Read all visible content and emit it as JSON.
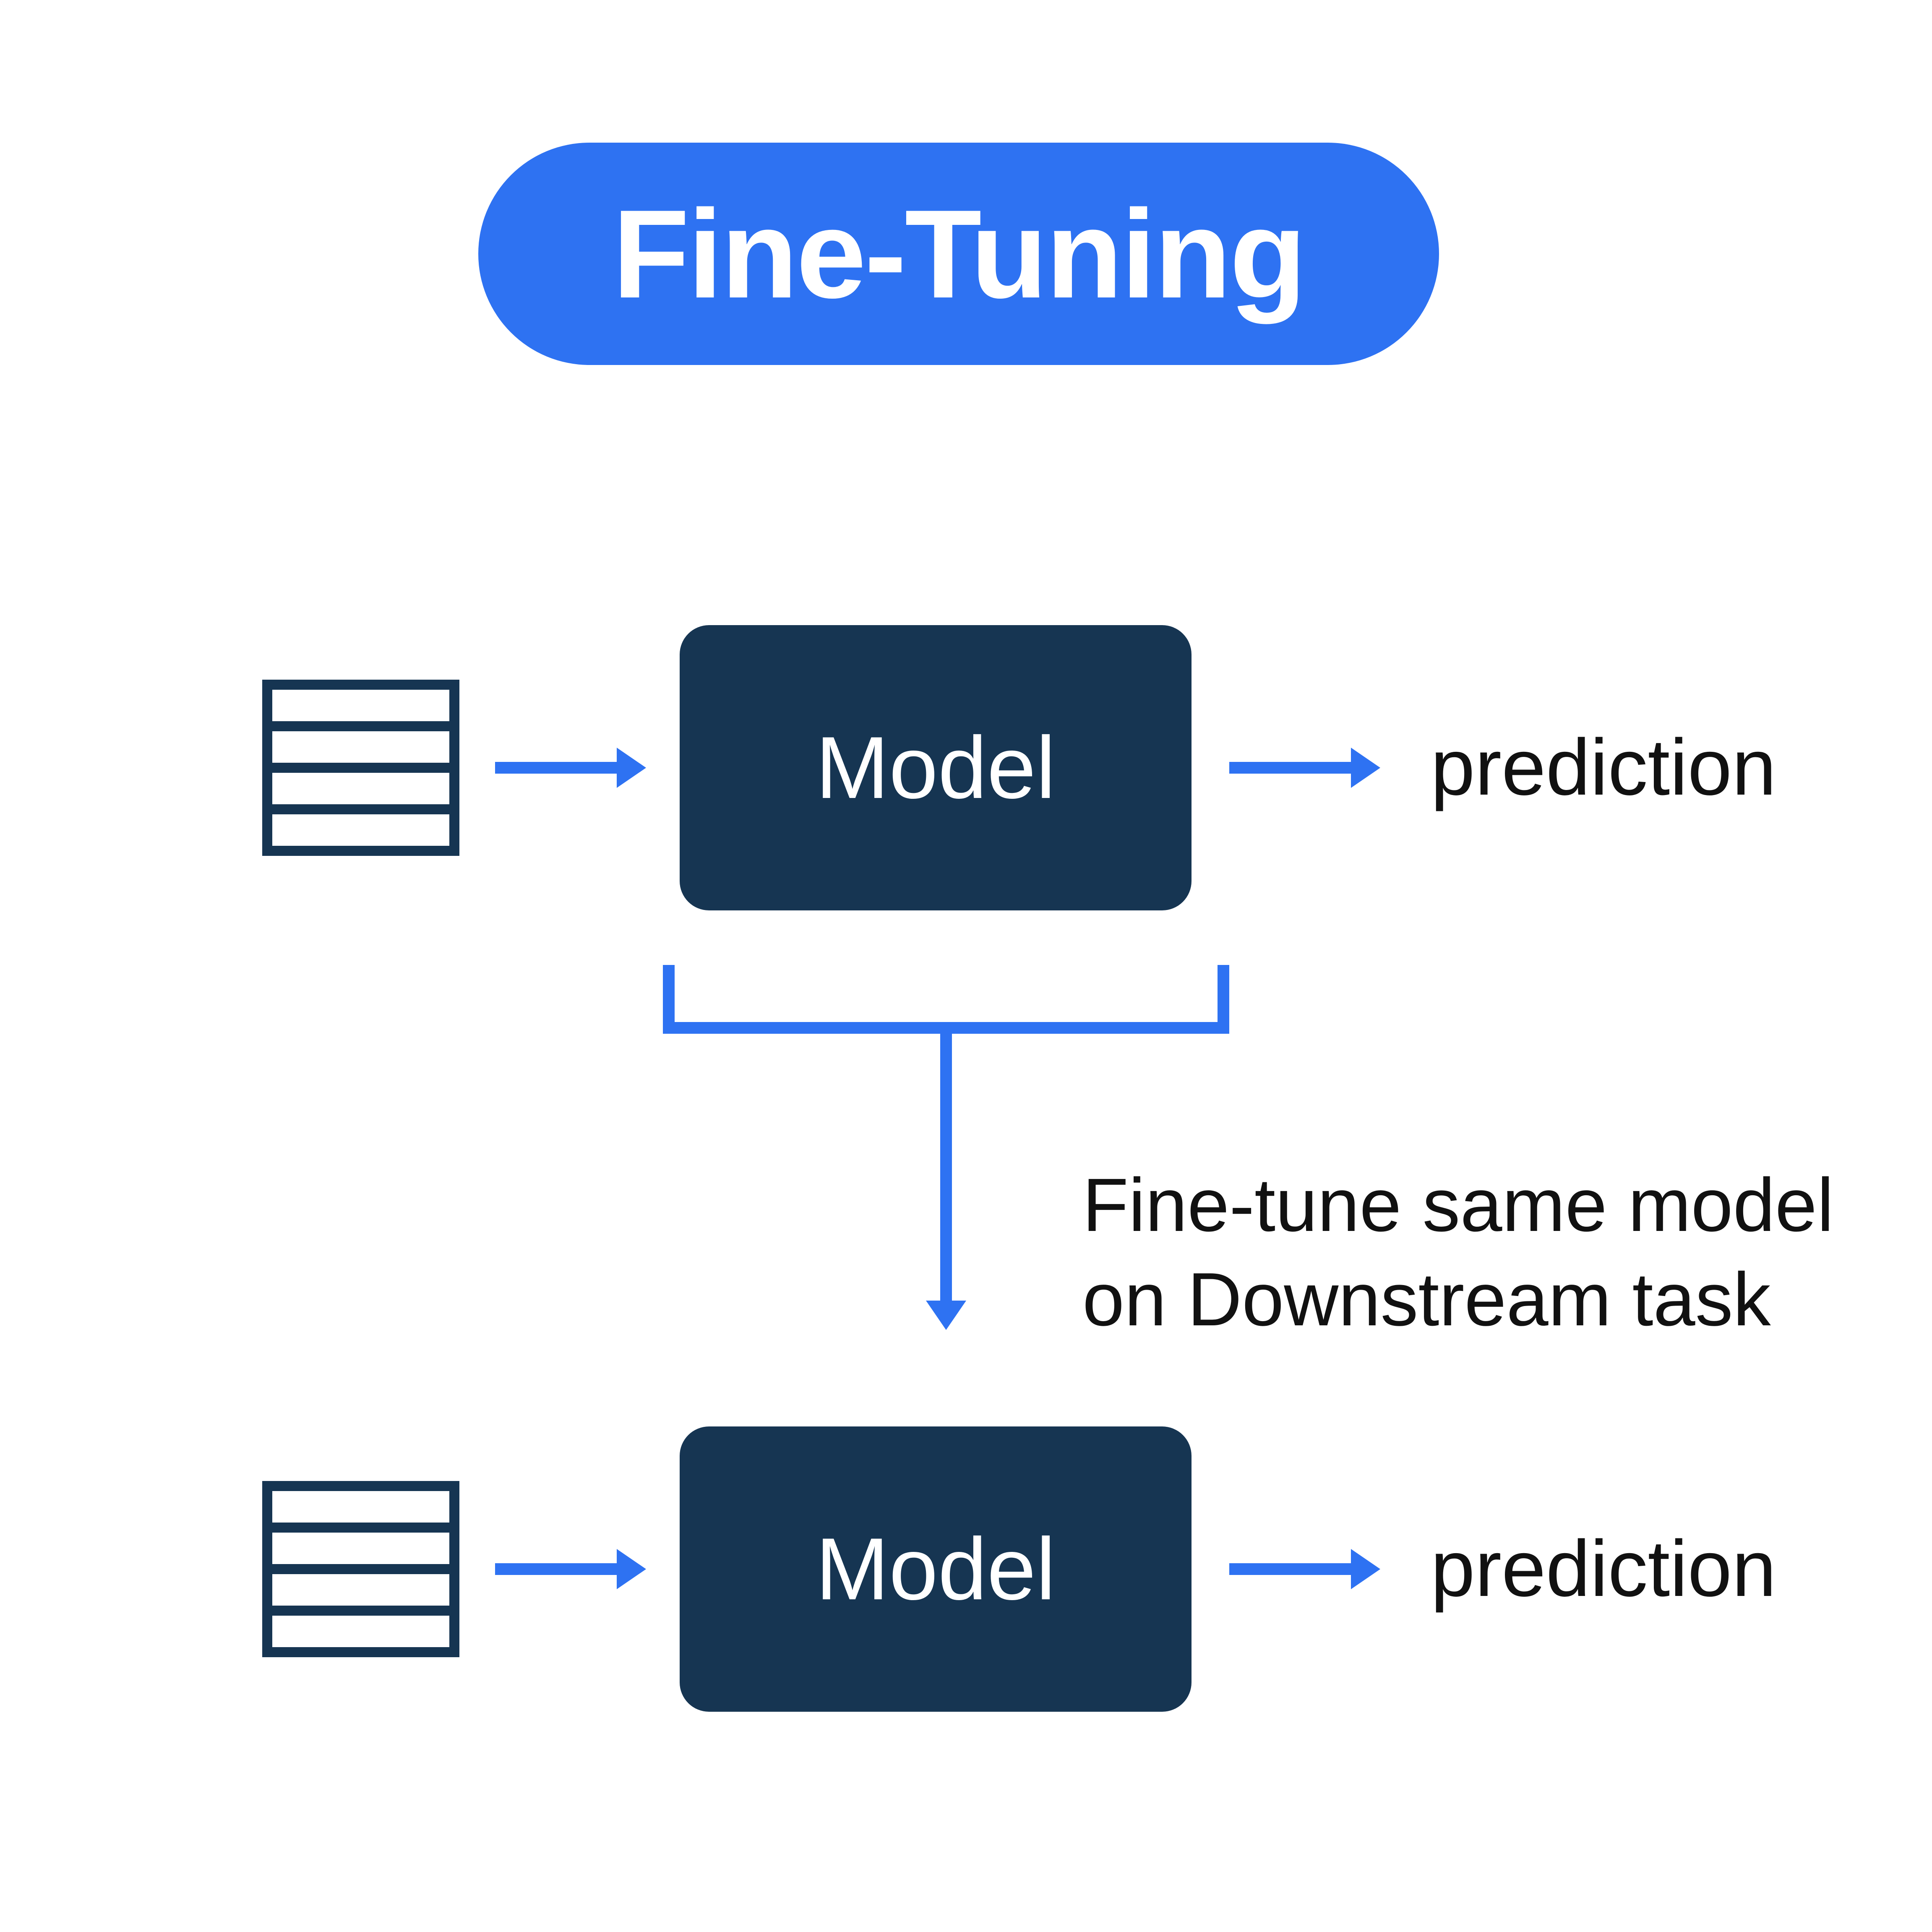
{
  "title": "Fine-Tuning",
  "row1": {
    "model_label": "Model",
    "output_label": "prediction"
  },
  "bracket_caption_line1": "Fine-tune same model",
  "bracket_caption_line2": "on Downstream task",
  "row2": {
    "model_label": "Model",
    "output_label": "prediction"
  },
  "colors": {
    "accent": "#2e72f2",
    "box": "#163552",
    "stroke_dark": "#163552"
  }
}
